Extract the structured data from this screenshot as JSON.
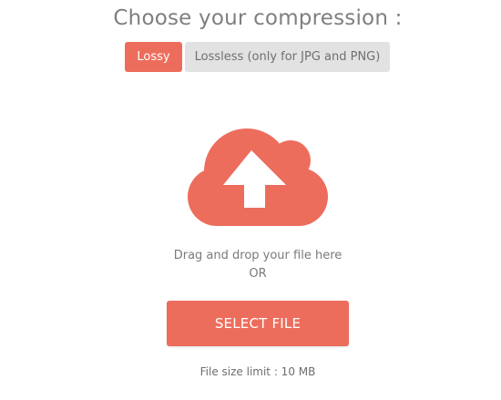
{
  "heading": "Choose your compression :",
  "compression_tabs": [
    {
      "label": "Lossy",
      "selected": true
    },
    {
      "label": "Lossless (only for JPG and PNG)",
      "selected": false
    }
  ],
  "upload_icon": "cloud-upload-icon",
  "drop_zone": {
    "instruction": "Drag and drop your file here",
    "separator": "OR"
  },
  "select_file_label": "SELECT FILE",
  "file_size_limit": "File size limit : 10 MB",
  "colors": {
    "accent": "#ed6d5d",
    "tab_inactive_bg": "#e2e2e2",
    "text": "#7a7a7a"
  }
}
